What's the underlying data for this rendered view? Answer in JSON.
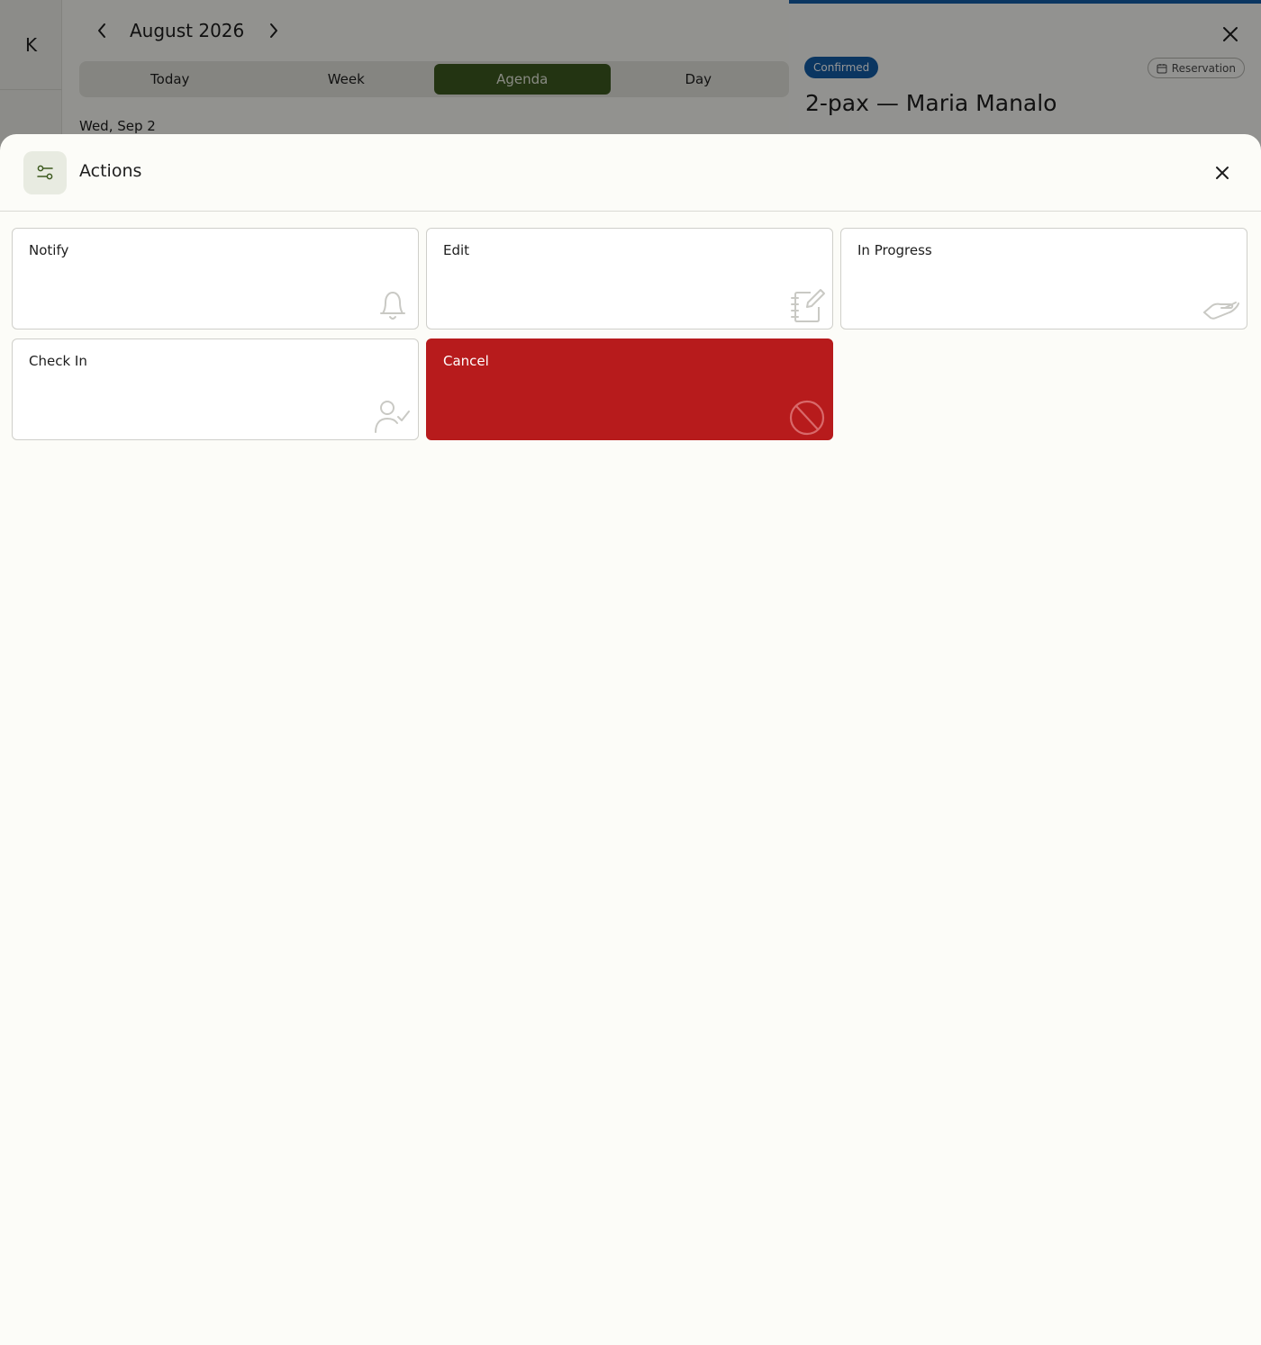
{
  "app": {
    "logo_letter": "K"
  },
  "calendar": {
    "month_title": "August 2026",
    "tabs": [
      {
        "label": "Today"
      },
      {
        "label": "Week"
      },
      {
        "label": "Agenda"
      },
      {
        "label": "Day"
      }
    ],
    "active_tab": "Agenda",
    "day_label": "Wed, Sep 2"
  },
  "detail": {
    "status": "Confirmed",
    "type_chip": "Reservation",
    "title": "2-pax — Maria Manalo",
    "accent_color": "#135ea8"
  },
  "actions_sheet": {
    "title": "Actions",
    "items": [
      {
        "label": "Notify",
        "icon": "bell-icon"
      },
      {
        "label": "Edit",
        "icon": "notebook-pen-icon"
      },
      {
        "label": "In Progress",
        "icon": "handshake-icon"
      },
      {
        "label": "Check In",
        "icon": "user-check-icon"
      },
      {
        "label": "Cancel",
        "icon": "ban-icon",
        "variant": "danger"
      }
    ],
    "danger_color": "#b71b1c"
  }
}
